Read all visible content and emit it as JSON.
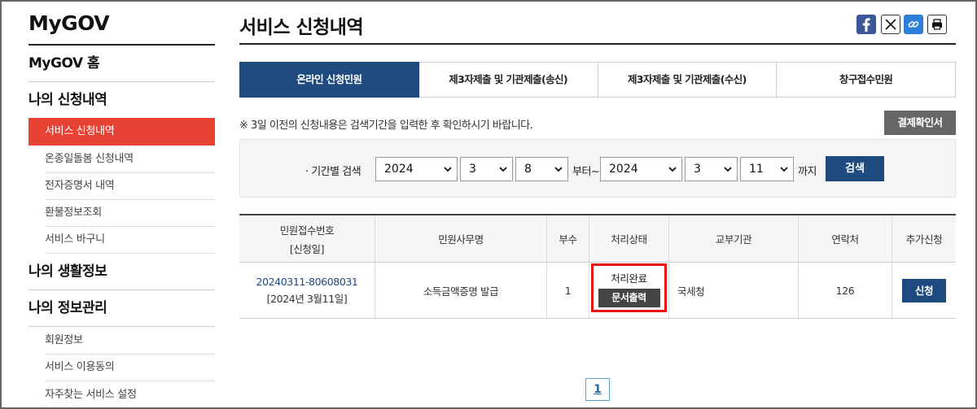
{
  "sidebar": {
    "logo": "MyGOV",
    "home": "MyGOV 홈",
    "section1": "나의 신청내역",
    "section1_items": [
      {
        "label": "서비스 신청내역",
        "active": true
      },
      {
        "label": "온종일돌봄 신청내역",
        "active": false
      },
      {
        "label": "전자증명서 내역",
        "active": false
      },
      {
        "label": "환불정보조회",
        "active": false
      },
      {
        "label": "서비스 바구니",
        "active": false
      }
    ],
    "section2": "나의 생활정보",
    "section3": "나의 정보관리",
    "section3_items": [
      {
        "label": "회원정보"
      },
      {
        "label": "서비스 이용동의"
      },
      {
        "label": "자주찾는 서비스 설정"
      }
    ]
  },
  "header": {
    "title": "서비스 신청내역",
    "share_icons": [
      "facebook-icon",
      "x-icon",
      "link-icon",
      "print-icon"
    ]
  },
  "tabs": [
    {
      "label": "온라인 신청민원",
      "active": true
    },
    {
      "label": "제3자제출 및 기관제출(송신)",
      "active": false
    },
    {
      "label": "제3자제출 및 기관제출(수신)",
      "active": false
    },
    {
      "label": "창구접수민원",
      "active": false
    }
  ],
  "notice": "※ 3일 이전의 신청내용은 검색기간을 입력한 후 확인하시기 바랍니다.",
  "receipt_button": "결제확인서",
  "search": {
    "label": "· 기간별 검색",
    "from_year": "2024",
    "from_month": "3",
    "from_day": "8",
    "from_suffix": "부터~",
    "to_year": "2024",
    "to_month": "3",
    "to_day": "11",
    "to_suffix": "까지",
    "button": "검색"
  },
  "table": {
    "headers": {
      "number_line1": "민원접수번호",
      "number_line2": "[신청일]",
      "name": "민원사무명",
      "copies": "부수",
      "status": "처리상태",
      "agency": "교부기관",
      "contact": "연락처",
      "extra": "추가신청"
    },
    "rows": [
      {
        "number": "20240311-80608031",
        "date": "[2024년 3월11일]",
        "name": "소득금액증명 발급",
        "copies": "1",
        "status": "처리완료",
        "print_button": "문서출력",
        "agency": "국세청",
        "contact": "126",
        "apply_button": "신청"
      }
    ]
  },
  "pagination": {
    "current": "1"
  },
  "colors": {
    "accent": "#1f4a7f",
    "active_menu": "#e84234",
    "highlight": "#e8140b"
  }
}
